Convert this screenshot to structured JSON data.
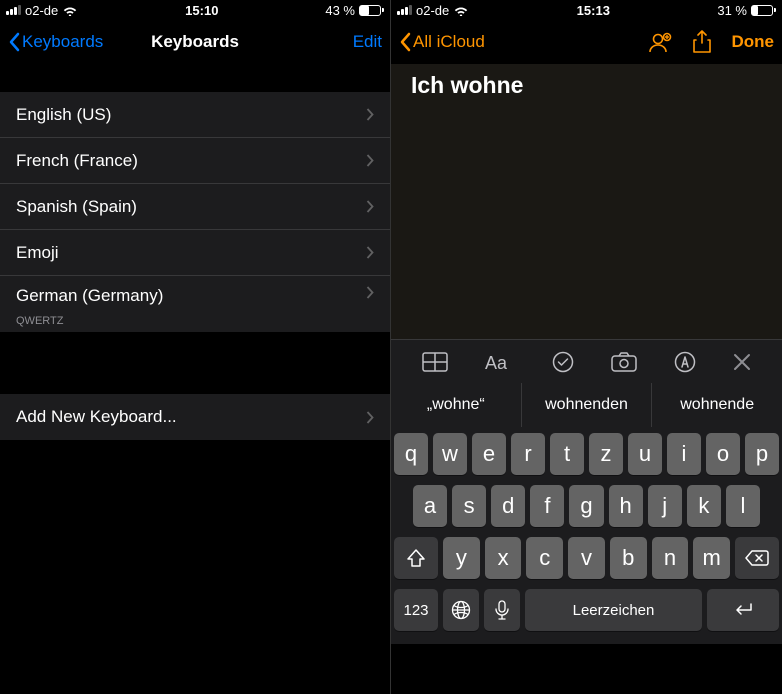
{
  "left": {
    "status": {
      "carrier": "o2-de",
      "time": "15:10",
      "battery_pct": "43 %",
      "battery_fill": 43
    },
    "nav": {
      "back": "Keyboards",
      "title": "Keyboards",
      "edit": "Edit"
    },
    "keyboards": [
      {
        "label": "English (US)",
        "sub": ""
      },
      {
        "label": "French (France)",
        "sub": ""
      },
      {
        "label": "Spanish (Spain)",
        "sub": ""
      },
      {
        "label": "Emoji",
        "sub": ""
      },
      {
        "label": "German (Germany)",
        "sub": "QWERTZ"
      }
    ],
    "add": "Add New Keyboard..."
  },
  "right": {
    "status": {
      "carrier": "o2-de",
      "time": "15:13",
      "battery_pct": "31 %",
      "battery_fill": 31
    },
    "nav": {
      "back": "All iCloud",
      "done": "Done"
    },
    "note_text": "Ich wohne",
    "suggestions": [
      "„wohne“",
      "wohnenden",
      "wohnende"
    ],
    "keys": {
      "row1": [
        "q",
        "w",
        "e",
        "r",
        "t",
        "z",
        "u",
        "i",
        "o",
        "p"
      ],
      "row2": [
        "a",
        "s",
        "d",
        "f",
        "g",
        "h",
        "j",
        "k",
        "l"
      ],
      "row3": [
        "y",
        "x",
        "c",
        "v",
        "b",
        "n",
        "m"
      ],
      "numkey": "123",
      "space": "Leerzeichen"
    }
  }
}
